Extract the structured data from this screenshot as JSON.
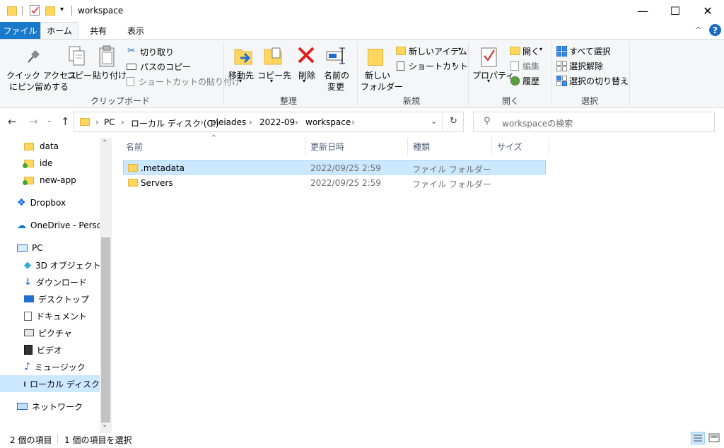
{
  "window": {
    "title": "workspace",
    "minimize": "—",
    "maximize": "☐",
    "close": "✕"
  },
  "tabs": [
    {
      "label": "ファイル"
    },
    {
      "label": "ホーム"
    },
    {
      "label": "共有"
    },
    {
      "label": "表示"
    }
  ],
  "ribbon": {
    "clipboard": {
      "pin_line1": "クイック アクセス",
      "pin_line2": "にピン留めする",
      "copy": "コピー",
      "paste": "貼り付け",
      "cut": "切り取り",
      "copy_path": "パスのコピー",
      "paste_shortcut": "ショートカットの貼り付け",
      "label": "クリップボード"
    },
    "organize": {
      "move_to": "移動先",
      "copy_to": "コピー先",
      "delete": "削除",
      "rename_line1": "名前の",
      "rename_line2": "変更",
      "label": "整理"
    },
    "new": {
      "new_folder_line1": "新しい",
      "new_folder_line2": "フォルダー",
      "new_item": "新しいアイテム",
      "shortcut": "ショートカット",
      "label": "新規"
    },
    "open": {
      "properties": "プロパティ",
      "open": "開く",
      "edit": "編集",
      "history": "履歴",
      "label": "開く"
    },
    "select": {
      "select_all": "すべて選択",
      "select_none": "選択解除",
      "invert": "選択の切り替え",
      "label": "選択"
    }
  },
  "address": {
    "crumbs": [
      "PC",
      "ローカル ディスク (C:)",
      "pleiades",
      "2022-09",
      "workspace"
    ],
    "search_placeholder": "workspaceの検索"
  },
  "nav": {
    "items": [
      {
        "label": "data"
      },
      {
        "label": "ide"
      },
      {
        "label": "new-app"
      },
      {
        "label": "Dropbox"
      },
      {
        "label": "OneDrive - Person"
      },
      {
        "label": "PC"
      },
      {
        "label": "3D オブジェクト"
      },
      {
        "label": "ダウンロード"
      },
      {
        "label": "デスクトップ"
      },
      {
        "label": "ドキュメント"
      },
      {
        "label": "ピクチャ"
      },
      {
        "label": "ビデオ"
      },
      {
        "label": "ミュージック"
      },
      {
        "label": "ローカル ディスク (C"
      },
      {
        "label": "ネットワーク"
      }
    ]
  },
  "columns": {
    "name": "名前",
    "modified": "更新日時",
    "type": "種類",
    "size": "サイズ"
  },
  "files": [
    {
      "name": ".metadata",
      "modified": "2022/09/25 2:59",
      "type": "ファイル フォルダー"
    },
    {
      "name": "Servers",
      "modified": "2022/09/25 2:59",
      "type": "ファイル フォルダー"
    }
  ],
  "status": {
    "count": "2 個の項目",
    "selected": "1 個の項目を選択"
  },
  "colors": {
    "file_tab": "#1979ca",
    "selection": "#cce8ff",
    "folder": "#ffd75e"
  }
}
